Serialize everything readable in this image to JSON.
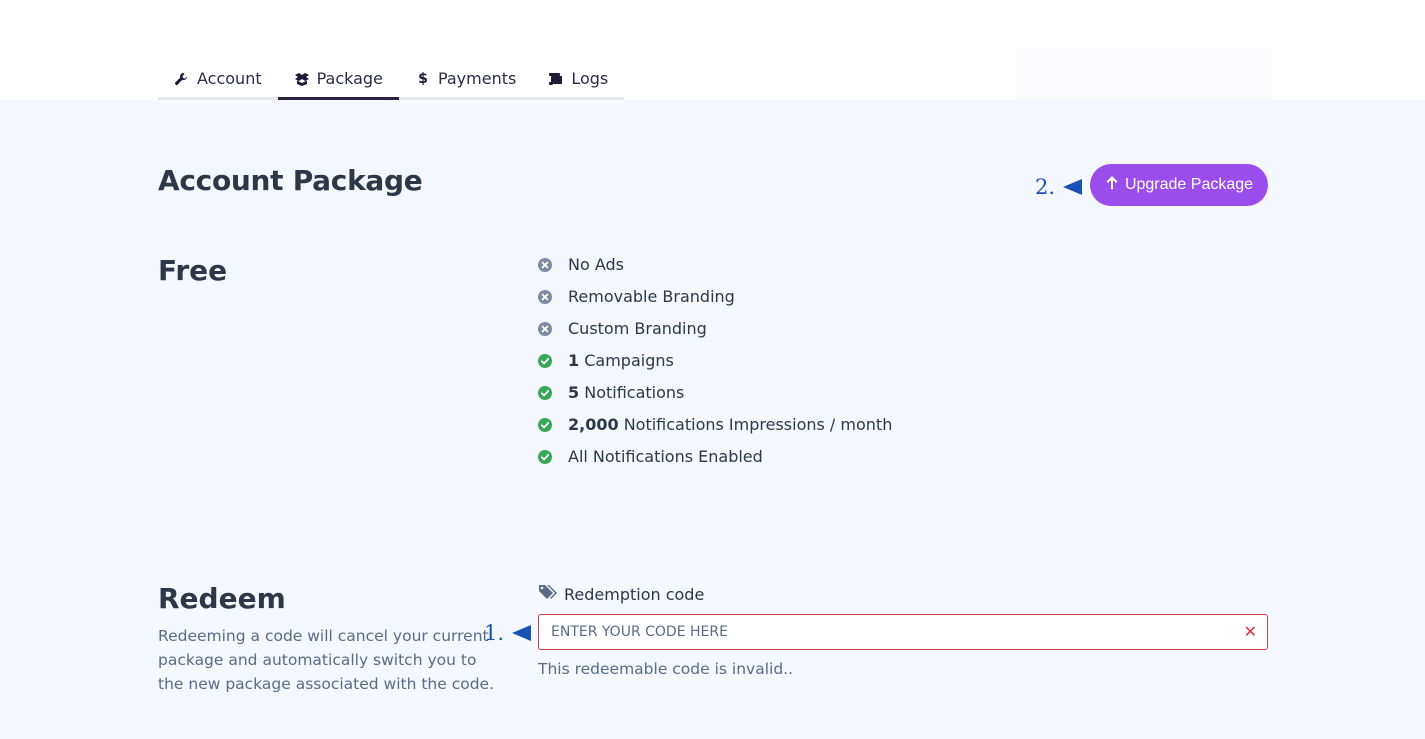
{
  "tabs": [
    {
      "label": "Account",
      "icon": "wrench-icon",
      "active": false
    },
    {
      "label": "Package",
      "icon": "box-icon",
      "active": true
    },
    {
      "label": "Payments",
      "icon": "dollar-icon",
      "active": false
    },
    {
      "label": "Logs",
      "icon": "logs-icon",
      "active": false
    }
  ],
  "header": {
    "title": "Account Package",
    "upgrade_label": "Upgrade Package",
    "upgrade_icon": "arrow-up-icon",
    "accent_color": "#9b4deb"
  },
  "annotations": {
    "one": "1.",
    "two": "2."
  },
  "plan": {
    "name": "Free",
    "features": [
      {
        "bold": "",
        "text": "No Ads",
        "included": false
      },
      {
        "bold": "",
        "text": "Removable Branding",
        "included": false
      },
      {
        "bold": "",
        "text": "Custom Branding",
        "included": false
      },
      {
        "bold": "1",
        "text": " Campaigns",
        "included": true
      },
      {
        "bold": "5",
        "text": " Notifications",
        "included": true
      },
      {
        "bold": "2,000",
        "text": " Notifications Impressions / month",
        "included": true
      },
      {
        "bold": "",
        "text": "All Notifications Enabled",
        "included": true
      }
    ],
    "included_color": "#38a856",
    "excluded_color": "#7f8aa3"
  },
  "redeem": {
    "title": "Redeem",
    "description": "Redeeming a code will cancel your current package and automatically switch you to the new package associated with the code.",
    "label": "Redemption code",
    "label_icon": "tags-icon",
    "placeholder": "ENTER YOUR CODE HERE",
    "value": "",
    "error": "This redeemable code is invalid..",
    "error_color": "#d9394d"
  }
}
